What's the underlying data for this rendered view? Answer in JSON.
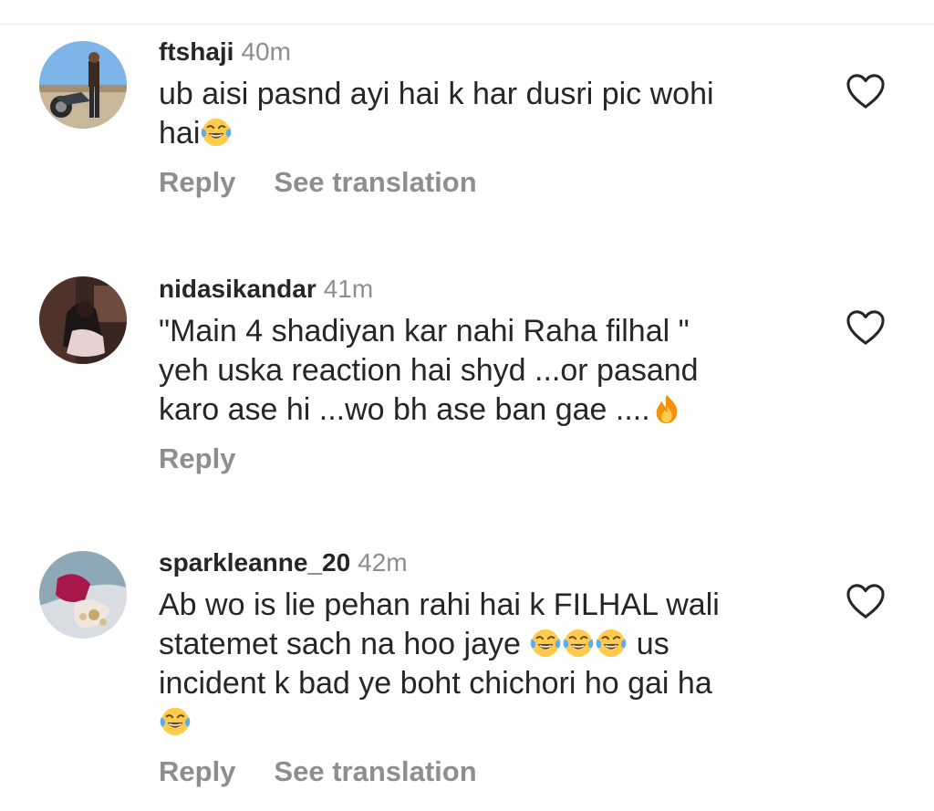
{
  "colors": {
    "text": "#262626",
    "muted": "#8e8e8e",
    "background": "#ffffff"
  },
  "comments": [
    {
      "username": "ftshaji",
      "time": "40m",
      "lines": [
        "ub aisi pasnd ayi hai k har dusri pic wohi",
        "hai"
      ],
      "emojis": [
        "face-with-tears-of-joy"
      ],
      "reply_label": "Reply",
      "translate_label": "See translation",
      "like_icon": "heart-outline-icon"
    },
    {
      "username": "nidasikandar",
      "time": "41m",
      "lines": [
        "\"Main 4 shadiyan kar nahi Raha filhal \"",
        "yeh uska reaction hai shyd ...or pasand",
        "karo ase hi ...wo bh ase ban gae ...."
      ],
      "emojis": [
        "fire"
      ],
      "reply_label": "Reply",
      "like_icon": "heart-outline-icon"
    },
    {
      "username": "sparkleanne_20",
      "time": "42m",
      "lines": [
        "Ab wo is lie pehan rahi hai k FILHAL wali",
        "statemet sach na hoo jaye ",
        " us",
        "incident k bad ye boht chichori ho gai ha"
      ],
      "emojis": [
        "face-with-tears-of-joy",
        "face-with-tears-of-joy",
        "face-with-tears-of-joy",
        "face-with-tears-of-joy"
      ],
      "reply_label": "Reply",
      "translate_label": "See translation",
      "like_icon": "heart-outline-icon"
    }
  ]
}
